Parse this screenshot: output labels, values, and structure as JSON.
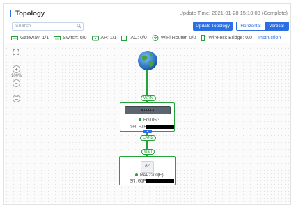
{
  "header": {
    "title": "Topology",
    "update_time": "Update Time: 2021-01-28 15:10:03 (Complete)"
  },
  "search": {
    "placeholder": "Search"
  },
  "buttons": {
    "update": "Update Topology",
    "horizontal": "Horizontal",
    "vertical": "Vertical"
  },
  "legend": [
    {
      "label": "Gateway: 1/1",
      "icon": "gateway-icon"
    },
    {
      "label": "Switch: 0/0",
      "icon": "switch-icon"
    },
    {
      "label": "AP: 1/1",
      "icon": "ap-icon"
    },
    {
      "label": "AC: 0/0",
      "icon": "ac-icon"
    },
    {
      "label": "WiFi Router: 0/0",
      "icon": "wifi-router-icon"
    },
    {
      "label": "Wireless Bridge: 0/0",
      "icon": "wireless-bridge-icon"
    }
  ],
  "instruction": "Instruction",
  "toolbar": {
    "zoom_level": "100%"
  },
  "nodes": {
    "gateway": {
      "name": "EG105G",
      "sn": "SN: H1P"
    },
    "ap": {
      "name": "RAP2200(E)",
      "sn": "SN: G1P",
      "label": "AP"
    }
  },
  "ports": {
    "wan": "WAN",
    "lan": "LAN2",
    "ap_port": "wan"
  },
  "colors": {
    "accent": "#2c6ee4",
    "online": "#25a23a"
  }
}
